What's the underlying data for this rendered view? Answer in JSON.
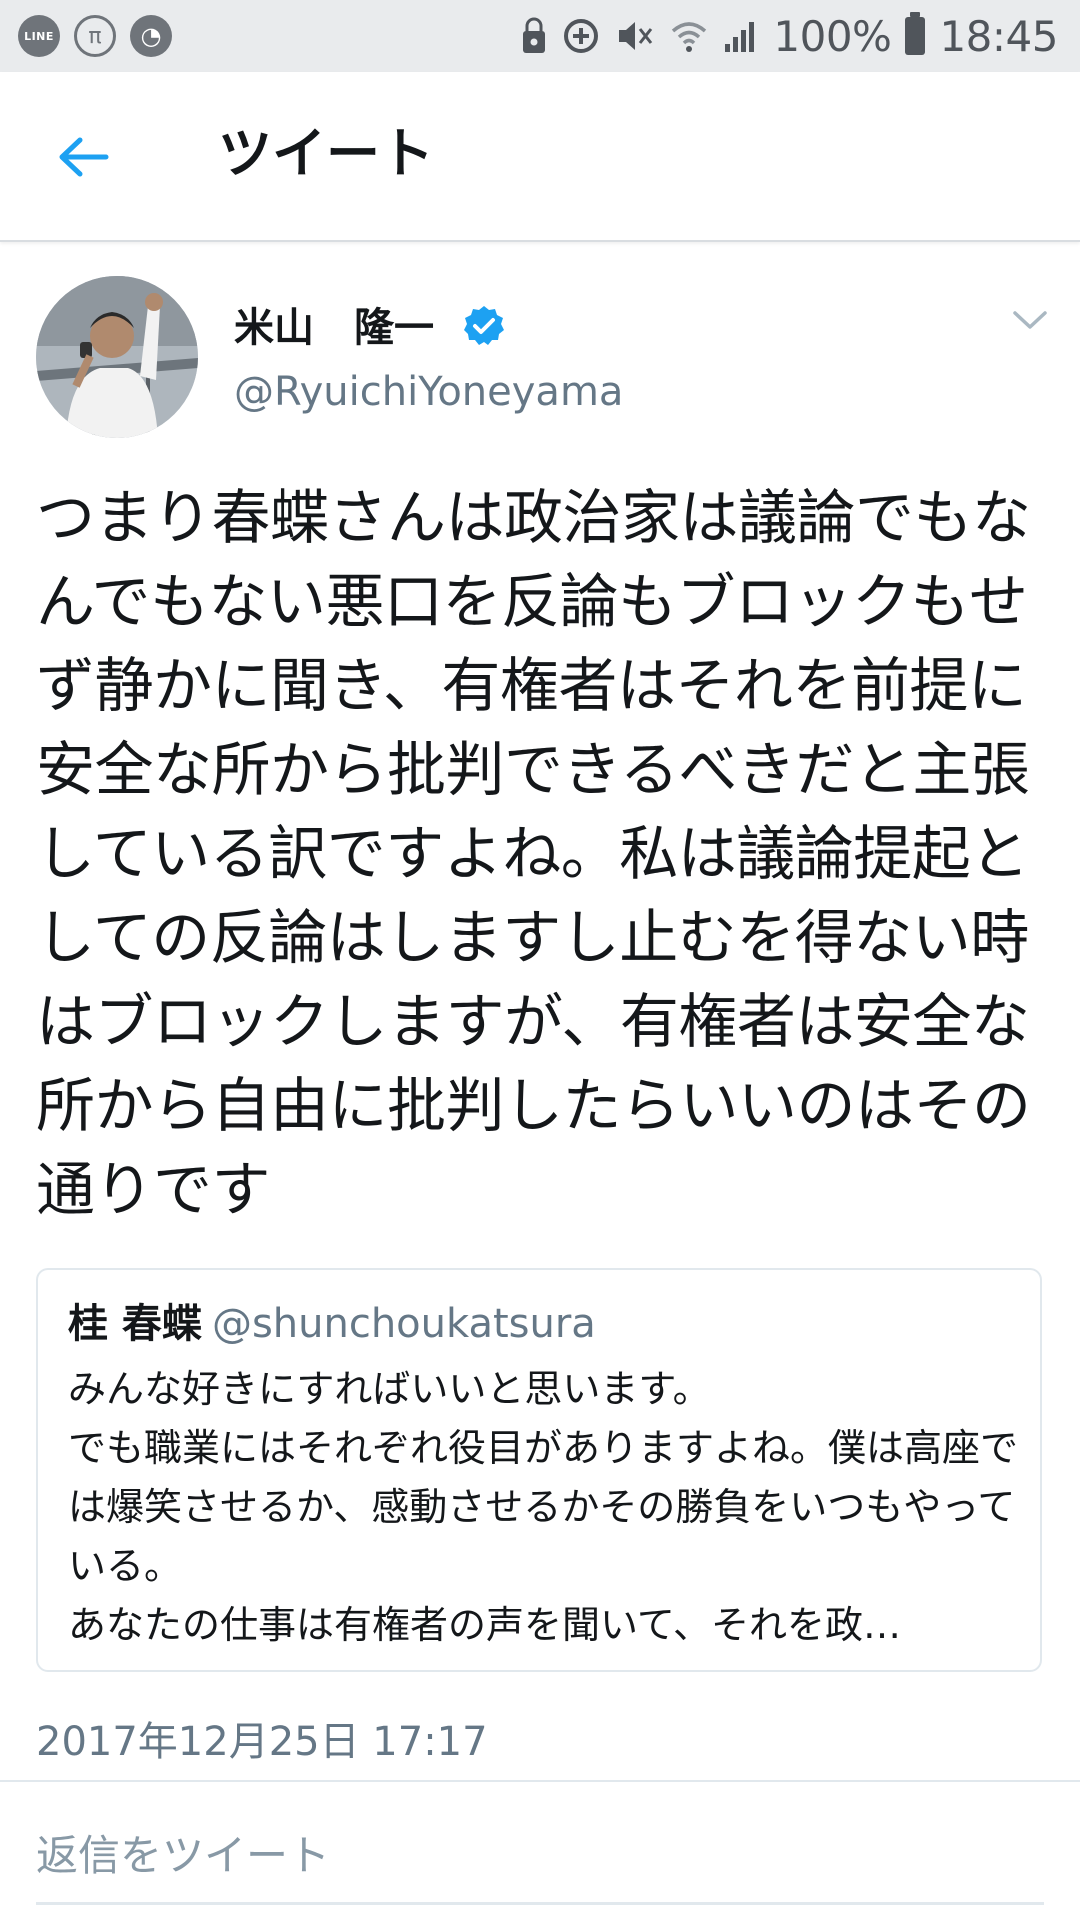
{
  "status_bar": {
    "left_icons": [
      "line-icon",
      "pi-icon",
      "swirl-icon"
    ],
    "line_label": "LINE",
    "pi_label": "π",
    "right_icons": [
      "lock-icon",
      "data-saver-icon",
      "mute-icon",
      "wifi-icon",
      "signal-icon",
      "battery-icon"
    ],
    "battery_percent": "100%",
    "time": "18:45"
  },
  "header": {
    "back_icon": "arrow-left-icon",
    "title": "ツイート"
  },
  "tweet": {
    "author_name": "米山　隆一",
    "verified": true,
    "handle": "@RyuichiYoneyama",
    "text": "つまり春蝶さんは政治家は議論でもなんでもない悪口を反論もブロックもせず静かに聞き、有権者はそれを前提に安全な所から批判できるべきだと主張している訳ですよね。私は議論提起としての反論はしますし止むを得ない時はブロックしますが、有権者は安全な所から自由に批判したらいいのはその通りです",
    "timestamp": "2017年12月25日 17:17"
  },
  "quoted_tweet": {
    "author_name": "桂 春蝶",
    "handle": "@shunchoukatsura",
    "text": "みんな好きにすればいいと思います。\nでも職業にはそれぞれ役目がありますよね。僕は高座では爆笑させるか、感動させるかその勝負をいつもやっている。\nあなたの仕事は有権者の声を聞いて、それを政…"
  },
  "reply": {
    "placeholder": "返信をツイート"
  },
  "colors": {
    "accent": "#1da1f2",
    "text": "#14171a",
    "secondary_text": "#657786",
    "status_bar_bg": "#e9ebed"
  }
}
